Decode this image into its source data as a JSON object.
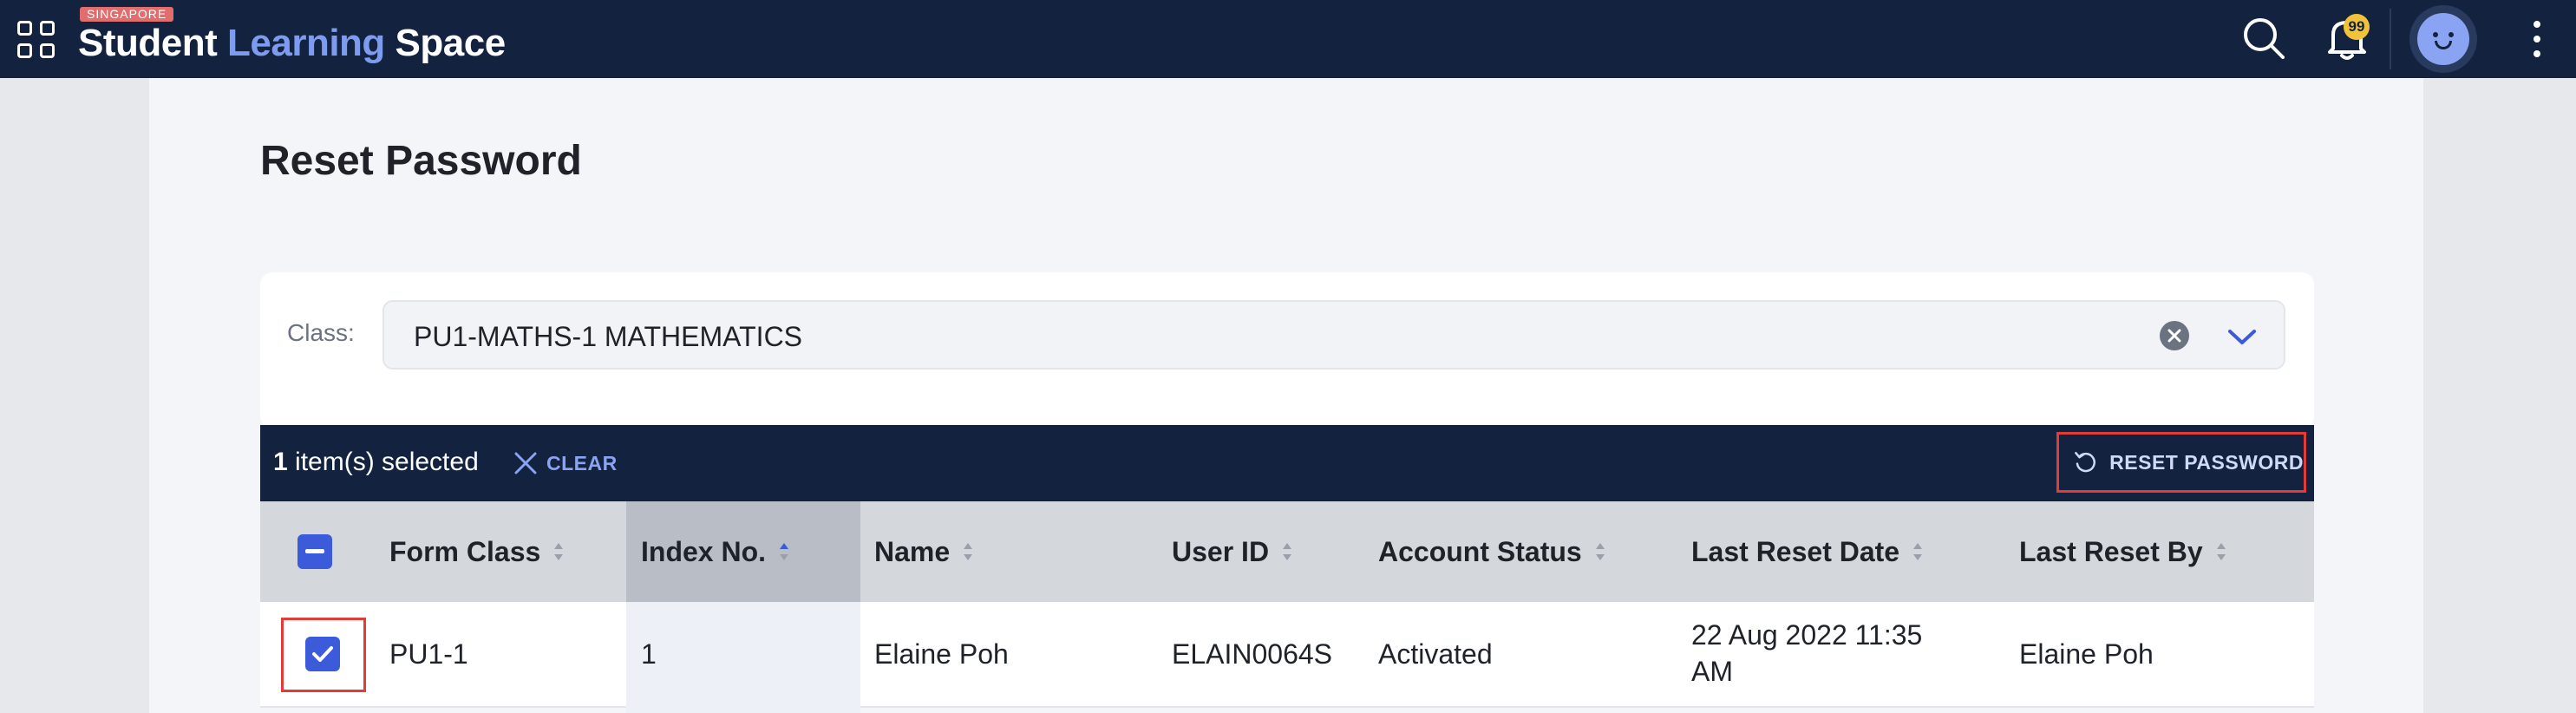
{
  "header": {
    "logo_badge": "SINGAPORE",
    "logo_part1": "Student",
    "logo_part2": "Learning",
    "logo_part3": "Space",
    "notification_count": "99"
  },
  "page": {
    "title": "Reset Password"
  },
  "filter": {
    "class_label": "Class:",
    "class_value": "PU1-MATHS-1 MATHEMATICS"
  },
  "selection": {
    "count": "1",
    "suffix": " item(s) selected",
    "clear_label": "CLEAR",
    "reset_label": "RESET PASSWORD"
  },
  "table": {
    "columns": [
      "Form Class",
      "Index No.",
      "Name",
      "User ID",
      "Account Status",
      "Last Reset Date",
      "Last Reset By"
    ],
    "sorted_column": "Index No.",
    "rows": [
      {
        "selected": true,
        "form_class": "PU1-1",
        "index_no": "1",
        "name": "Elaine Poh",
        "user_id": "ELAIN0064S",
        "account_status": "Activated",
        "last_reset_date_line1": "22 Aug 2022 11:35",
        "last_reset_date_line2": "AM",
        "last_reset_by": "Elaine Poh"
      }
    ]
  },
  "colors": {
    "topbar": "#13223f",
    "accent": "#3b5bdb",
    "highlight": "#e23c36",
    "brand_blue": "#7d9cf0"
  }
}
